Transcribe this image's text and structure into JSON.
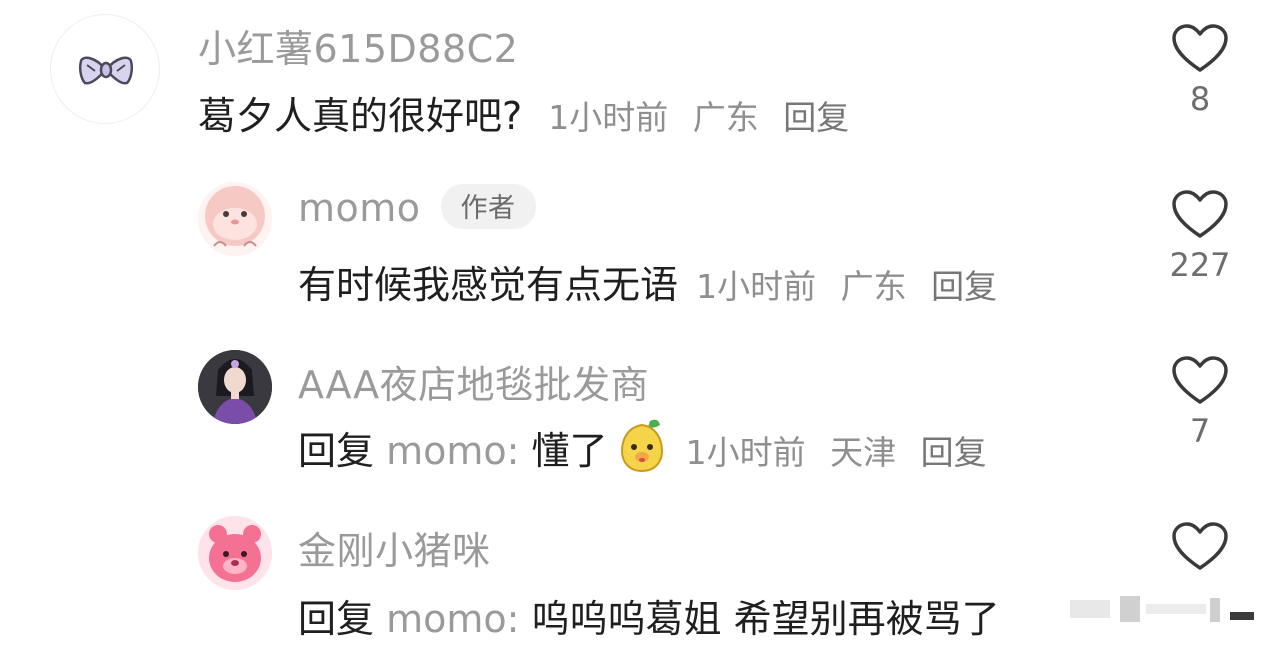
{
  "comments": [
    {
      "username": "小红薯615D88C2",
      "text": "葛夕人真的很好吧?",
      "time": "1小时前",
      "location": "广东",
      "reply_label": "回复",
      "likes": "8",
      "avatar_icon": "bow-icon"
    },
    {
      "username": "momo",
      "badge": "作者",
      "text": "有时候我感觉有点无语",
      "time": "1小时前",
      "location": "广东",
      "reply_label": "回复",
      "likes": "227",
      "avatar_icon": "pink-seal-avatar"
    },
    {
      "username": "AAA夜店地毯批发商",
      "reply_prefix": "回复",
      "reply_target": "momo:",
      "text": "懂了",
      "emoji": "pear-face-emoji",
      "time": "1小时前",
      "location": "天津",
      "reply_label": "回复",
      "likes": "7",
      "avatar_icon": "costume-woman-avatar"
    },
    {
      "username": "金刚小猪咪",
      "reply_prefix": "回复",
      "reply_target": "momo:",
      "text": "呜呜呜葛姐 希望别再被骂了",
      "avatar_icon": "pink-bear-avatar"
    }
  ],
  "colors": {
    "username": "#9a9a9a",
    "text": "#1f1f1f",
    "meta": "#8f8f8f",
    "badge_bg": "#f1f1f1"
  }
}
